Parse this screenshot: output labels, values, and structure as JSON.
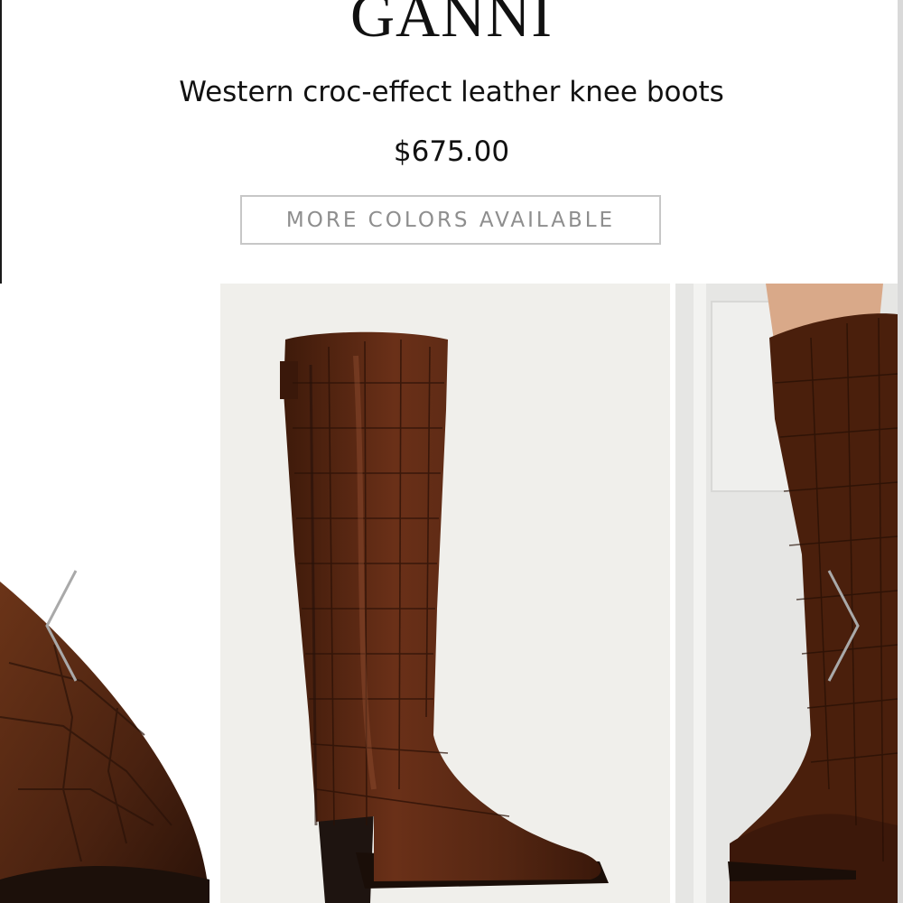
{
  "product": {
    "brand": "GANNI",
    "name": "Western croc-effect leather knee boots",
    "price": "$675.00",
    "colors_button": "MORE COLORS AVAILABLE"
  },
  "gallery": {
    "icons": {
      "prev": "chevron-left-icon",
      "next": "chevron-right-icon"
    },
    "colors": {
      "leather": "#5a2a14",
      "leather_dark": "#3a1a0c",
      "heel": "#1e1410",
      "main_bg": "#f0efeb",
      "arrow": "#a9a9a9"
    }
  }
}
